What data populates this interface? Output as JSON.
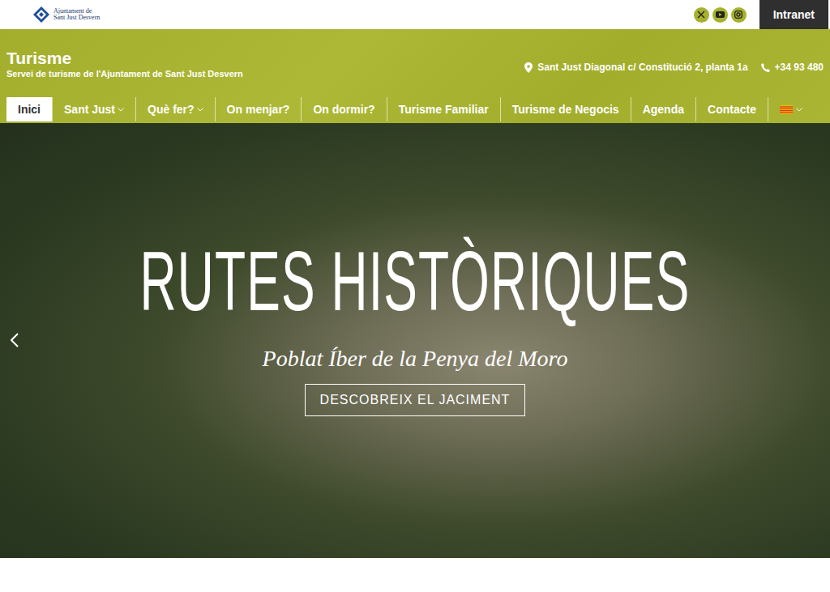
{
  "header": {
    "logo_lines": [
      "Ajuntament de",
      "Sant Just Desvern"
    ],
    "intranet": "Intranet"
  },
  "site": {
    "title": "Turisme",
    "subtitle": "Servei de turisme de l'Ajuntament de Sant Just Desvern"
  },
  "contact": {
    "address": "Sant Just Diagonal c/ Constitució 2, planta 1a",
    "phone": "+34 93 480"
  },
  "nav": [
    {
      "label": "Inici",
      "selected": true,
      "has_menu": false
    },
    {
      "label": "Sant Just",
      "selected": false,
      "has_menu": true
    },
    {
      "label": "Què fer?",
      "selected": false,
      "has_menu": true
    },
    {
      "label": "On menjar?",
      "selected": false,
      "has_menu": false
    },
    {
      "label": "On dormir?",
      "selected": false,
      "has_menu": false
    },
    {
      "label": "Turisme Familiar",
      "selected": false,
      "has_menu": false
    },
    {
      "label": "Turisme de Negocis",
      "selected": false,
      "has_menu": false
    },
    {
      "label": "Agenda",
      "selected": false,
      "has_menu": false
    },
    {
      "label": "Contacte",
      "selected": false,
      "has_menu": false
    }
  ],
  "language": {
    "has_menu": true
  },
  "hero": {
    "title": "RUTES HISTÒRIQUES",
    "subtitle": "Poblat Íber de la Penya del Moro",
    "button": "DESCOBREIX EL JACIMENT"
  }
}
